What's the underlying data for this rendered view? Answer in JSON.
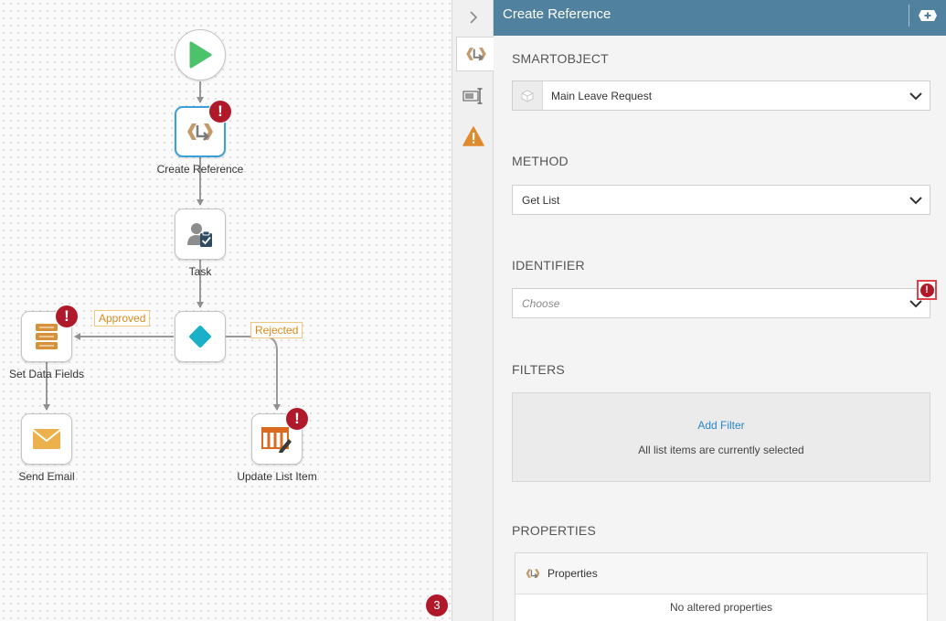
{
  "canvas": {
    "nodes": {
      "start": {
        "icon": "play-icon"
      },
      "create_reference": {
        "label": "Create Reference",
        "icon": "create-reference-icon",
        "error": "!"
      },
      "task": {
        "label": "Task",
        "icon": "user-task-icon"
      },
      "decision": {
        "icon": "decision-diamond-icon"
      },
      "set_data_fields": {
        "label": "Set Data Fields",
        "icon": "data-fields-icon",
        "error": "!"
      },
      "send_email": {
        "label": "Send Email",
        "icon": "envelope-icon"
      },
      "update_list_item": {
        "label": "Update List Item",
        "icon": "list-edit-icon",
        "error": "!"
      }
    },
    "line_labels": {
      "approved": "Approved",
      "rejected": "Rejected"
    },
    "error_count": "3"
  },
  "rail": {
    "items": [
      {
        "icon": "create-reference-icon",
        "active": true
      },
      {
        "icon": "text-field-icon",
        "active": false
      },
      {
        "icon": "warning-icon",
        "active": false
      }
    ],
    "collapse_icon": "chevron-right-icon"
  },
  "panel": {
    "title": "Create Reference",
    "header_button_icon": "add-icon",
    "smartobject": {
      "title": "SMARTOBJECT",
      "value": "Main Leave Request",
      "icon": "smartobject-cube-icon"
    },
    "method": {
      "title": "METHOD",
      "value": "Get List"
    },
    "identifier": {
      "title": "IDENTIFIER",
      "placeholder": "Choose",
      "error": "!"
    },
    "filters": {
      "title": "FILTERS",
      "add_label": "Add Filter",
      "note": "All list items are currently selected"
    },
    "properties": {
      "title": "PROPERTIES",
      "header_label": "Properties",
      "empty_text": "No altered properties"
    }
  },
  "colors": {
    "header": "#50819e",
    "error": "#b0192a",
    "start_green": "#4cc26a",
    "decision_teal": "#19b0c8",
    "accent_orange": "#d6923a",
    "link_blue": "#2a86c9"
  }
}
